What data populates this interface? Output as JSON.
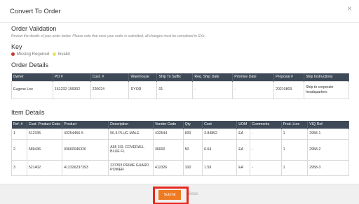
{
  "header": {
    "title": "Convert To Order",
    "close_icon": "×"
  },
  "validation": {
    "title": "Order Validation",
    "note": "Review the details of your order below. Please note that once your order is submitted, all changes must be completed in SXe."
  },
  "key": {
    "title": "Key",
    "missing_label": "Missing Required",
    "invalid_label": "Invalid",
    "missing_color": "#c0392b",
    "invalid_color": "#f2e15a"
  },
  "order_details": {
    "title": "Order Details",
    "columns": [
      "Owner",
      "PO #",
      "Cust. #",
      "Warehouse",
      "Ship To Suffix",
      "Req. Ship Date",
      "Promise Date",
      "Proposal #",
      "Ship Instructions"
    ],
    "row": [
      "Eugene Lee",
      "151232-199302",
      "220024",
      "DYOR",
      "01",
      "-",
      "-",
      "20210803",
      "Ship to corporate headquarters"
    ]
  },
  "item_details": {
    "title": "Item Details",
    "columns": [
      "Ref. #",
      "Cust. Product Code",
      "Product",
      "Description",
      "Vendor Code",
      "Qty",
      "Cost",
      "UOM",
      "Comments",
      "Prod. Line",
      "VIQ Ref."
    ],
    "rows": [
      [
        "1",
        "512335",
        "43254456-5",
        "56-5 PLUG MALE",
        "432544",
        "600",
        "3.84852",
        "EA",
        "-",
        "1",
        "2958-1"
      ],
      [
        "2",
        "589436",
        "03600045326",
        "A65 3XL COVERALL BLUE FL",
        "36000",
        "50",
        "6.64",
        "EA",
        "-",
        "1",
        "2958-2"
      ],
      [
        "3",
        "521402",
        "412326237393",
        "237393 PRIME GUARD POWER",
        "412326",
        "100",
        "1.59",
        "EA",
        "-",
        "1",
        "2958-3"
      ]
    ]
  },
  "footer": {
    "submit_label": "Submit",
    "back_label": "Back",
    "accent": "#ee7a22",
    "highlight_color": "#e8271c"
  }
}
